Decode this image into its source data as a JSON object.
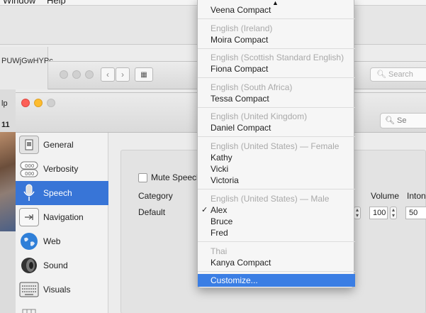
{
  "menubar": {
    "items": [
      "Window",
      "Help"
    ]
  },
  "browser": {
    "url_fragment": "PUWjGwHYPc",
    "tab_fragment": "lp",
    "tab_number": "11"
  },
  "finder": {
    "view_icon": "grid-icon",
    "search_placeholder": "Search"
  },
  "voiceover": {
    "search_placeholder": "Se",
    "sidebar": [
      {
        "label": "General",
        "icon": "general-icon"
      },
      {
        "label": "Verbosity",
        "icon": "verbosity-icon"
      },
      {
        "label": "Speech",
        "icon": "microphone-icon",
        "selected": true
      },
      {
        "label": "Navigation",
        "icon": "navigation-icon"
      },
      {
        "label": "Web",
        "icon": "globe-icon"
      },
      {
        "label": "Sound",
        "icon": "speaker-icon"
      },
      {
        "label": "Visuals",
        "icon": "keyboard-icon"
      }
    ],
    "main": {
      "mute_label": "Mute Speech",
      "headers": {
        "category": "Category",
        "volume": "Volume",
        "intonation": "Inton"
      },
      "row": {
        "category": "Default",
        "volume": "100",
        "intonation": "50"
      }
    }
  },
  "voice_menu": {
    "top_item": "Veena Compact",
    "groups": [
      {
        "heading": "English (Ireland)",
        "items": [
          "Moira Compact"
        ]
      },
      {
        "heading": "English (Scottish Standard English)",
        "items": [
          "Fiona Compact"
        ]
      },
      {
        "heading": "English (South Africa)",
        "items": [
          "Tessa Compact"
        ]
      },
      {
        "heading": "English (United Kingdom)",
        "items": [
          "Daniel Compact"
        ]
      },
      {
        "heading": "English (United States) — Female",
        "items": [
          "Kathy",
          "Vicki",
          "Victoria"
        ]
      },
      {
        "heading": "English (United States) — Male",
        "items": [
          "Alex",
          "Bruce",
          "Fred"
        ],
        "checked": "Alex"
      },
      {
        "heading": "Thai",
        "items": [
          "Kanya Compact"
        ]
      }
    ],
    "customize": "Customize..."
  },
  "colors": {
    "selection": "#3875d7",
    "menu_highlight": "#3b7ee4",
    "close": "#fc5f57",
    "minimize": "#fdbc2e"
  }
}
